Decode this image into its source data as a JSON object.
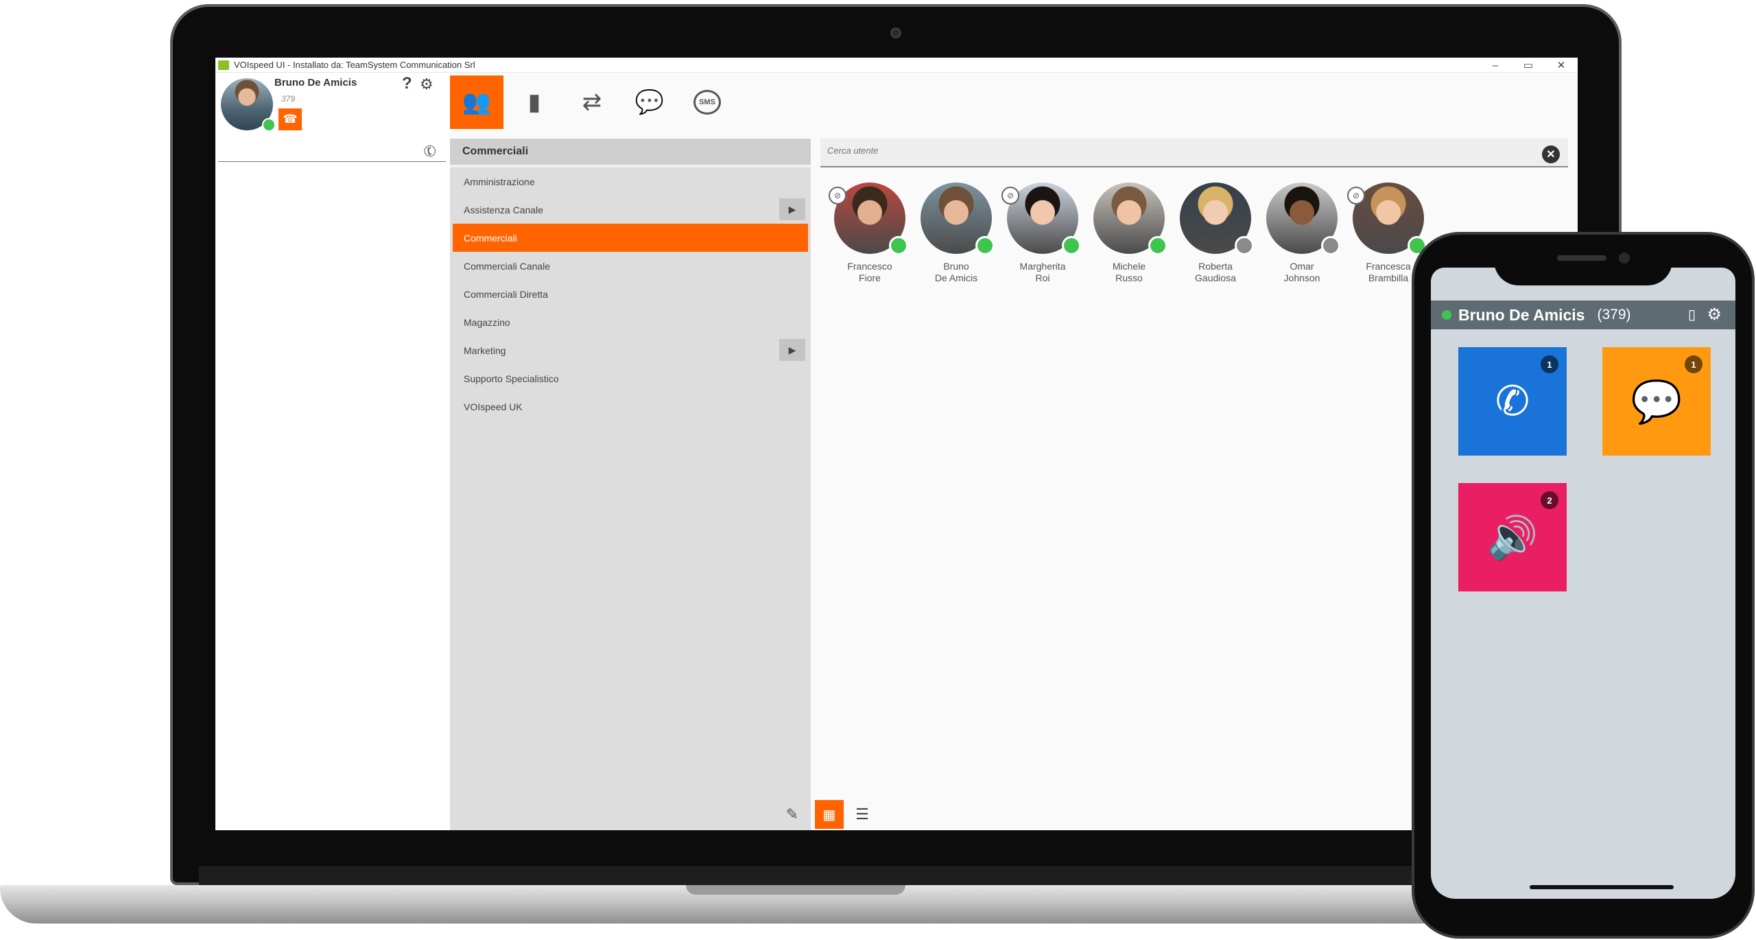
{
  "window": {
    "title": "VOIspeed UI - Installato da: TeamSystem Communication Srl",
    "controls": {
      "minimize": "–",
      "restore": "▭",
      "close": "✕"
    }
  },
  "me": {
    "name": "Bruno De Amicis",
    "extension": "379",
    "status_color": "#3fc44d",
    "phone_icon": "☎"
  },
  "header_icons": {
    "help": "?",
    "settings": "⚙"
  },
  "dialer": {
    "icon": "✆"
  },
  "toolbar": {
    "tabs": [
      {
        "name": "users-tab",
        "icon": "👥",
        "active": true
      },
      {
        "name": "phonebook-tab",
        "icon": "▮"
      },
      {
        "name": "call-history-tab",
        "icon": "⇄"
      },
      {
        "name": "chat-tab",
        "icon": "💬"
      },
      {
        "name": "sms-tab",
        "icon": "SMS"
      }
    ]
  },
  "groups": {
    "header": "Commerciali",
    "items": [
      {
        "label": "Amministrazione"
      },
      {
        "label": "Assistenza Canale",
        "has_arrow": true
      },
      {
        "label": "Commerciali",
        "active": true
      },
      {
        "label": "Commerciali Canale"
      },
      {
        "label": "Commerciali Diretta"
      },
      {
        "label": "Magazzino"
      },
      {
        "label": "Marketing",
        "has_arrow": true
      },
      {
        "label": "Supporto Specialistico"
      },
      {
        "label": "VOIspeed UK"
      }
    ],
    "arrow_icon": "▶",
    "edit_icon": "✎"
  },
  "search": {
    "placeholder": "Cerca utente",
    "clear_icon": "✕"
  },
  "users": [
    {
      "name_line1": "Francesco",
      "name_line2": "Fiore",
      "status": "online",
      "dnd": true
    },
    {
      "name_line1": "Bruno",
      "name_line2": "De Amicis",
      "status": "online",
      "dnd": false
    },
    {
      "name_line1": "Margherita",
      "name_line2": "Roi",
      "status": "online",
      "dnd": true
    },
    {
      "name_line1": "Michele",
      "name_line2": "Russo",
      "status": "online",
      "dnd": false
    },
    {
      "name_line1": "Roberta",
      "name_line2": "Gaudiosa",
      "status": "offline",
      "dnd": false
    },
    {
      "name_line1": "Omar",
      "name_line2": "Johnson",
      "status": "offline",
      "dnd": false
    },
    {
      "name_line1": "Francesca",
      "name_line2": "Brambilla",
      "status": "online",
      "dnd": true
    }
  ],
  "status_colors": {
    "online": "#3fc44d",
    "offline": "#8a8a8a"
  },
  "view_toggle": {
    "grid_icon": "▦",
    "list_icon": "☰"
  },
  "mobile": {
    "name": "Bruno De Amicis",
    "extension": "(379)",
    "mobile_icon": "▯",
    "gear_icon": "⚙",
    "tiles": [
      {
        "name": "calls-tile",
        "icon": "✆",
        "badge": "1",
        "color": "#1a73d8"
      },
      {
        "name": "chat-tile",
        "icon": "💬",
        "badge": "1",
        "color": "#ff9a10"
      },
      {
        "name": "voicemail-tile",
        "icon": "🔊",
        "badge": "2",
        "color": "#e91e63"
      }
    ]
  }
}
